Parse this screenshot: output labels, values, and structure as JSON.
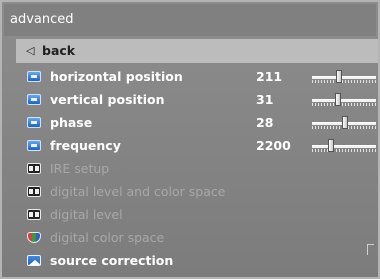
{
  "header": {
    "title": "advanced"
  },
  "menu": {
    "back": {
      "label": "back"
    },
    "items": [
      {
        "label": "horizontal position",
        "value": "211",
        "icon": "blue-square-icon",
        "slider_fraction": 0.42
      },
      {
        "label": "vertical position",
        "value": "31",
        "icon": "blue-square-icon",
        "slider_fraction": 0.4
      },
      {
        "label": "phase",
        "value": "28",
        "icon": "blue-square-icon",
        "slider_fraction": 0.52
      },
      {
        "label": "frequency",
        "value": "2200",
        "icon": "blue-square-icon",
        "slider_fraction": 0.3
      },
      {
        "label": "IRE setup",
        "icon": "ire-icon",
        "disabled": true
      },
      {
        "label": "digital level and color space",
        "icon": "ire-icon",
        "disabled": true
      },
      {
        "label": "digital level",
        "icon": "ire-icon",
        "disabled": true
      },
      {
        "label": "digital color space",
        "icon": "shield-icon",
        "disabled": true
      },
      {
        "label": "source correction",
        "icon": "mountain-icon"
      }
    ]
  },
  "colors": {
    "panel_bg": "#8a8a8a",
    "highlight_bg": "#bcbcbc",
    "text": "#ffffff",
    "disabled_text": "#a8a8a8",
    "accent_blue": "#2e76d8"
  }
}
